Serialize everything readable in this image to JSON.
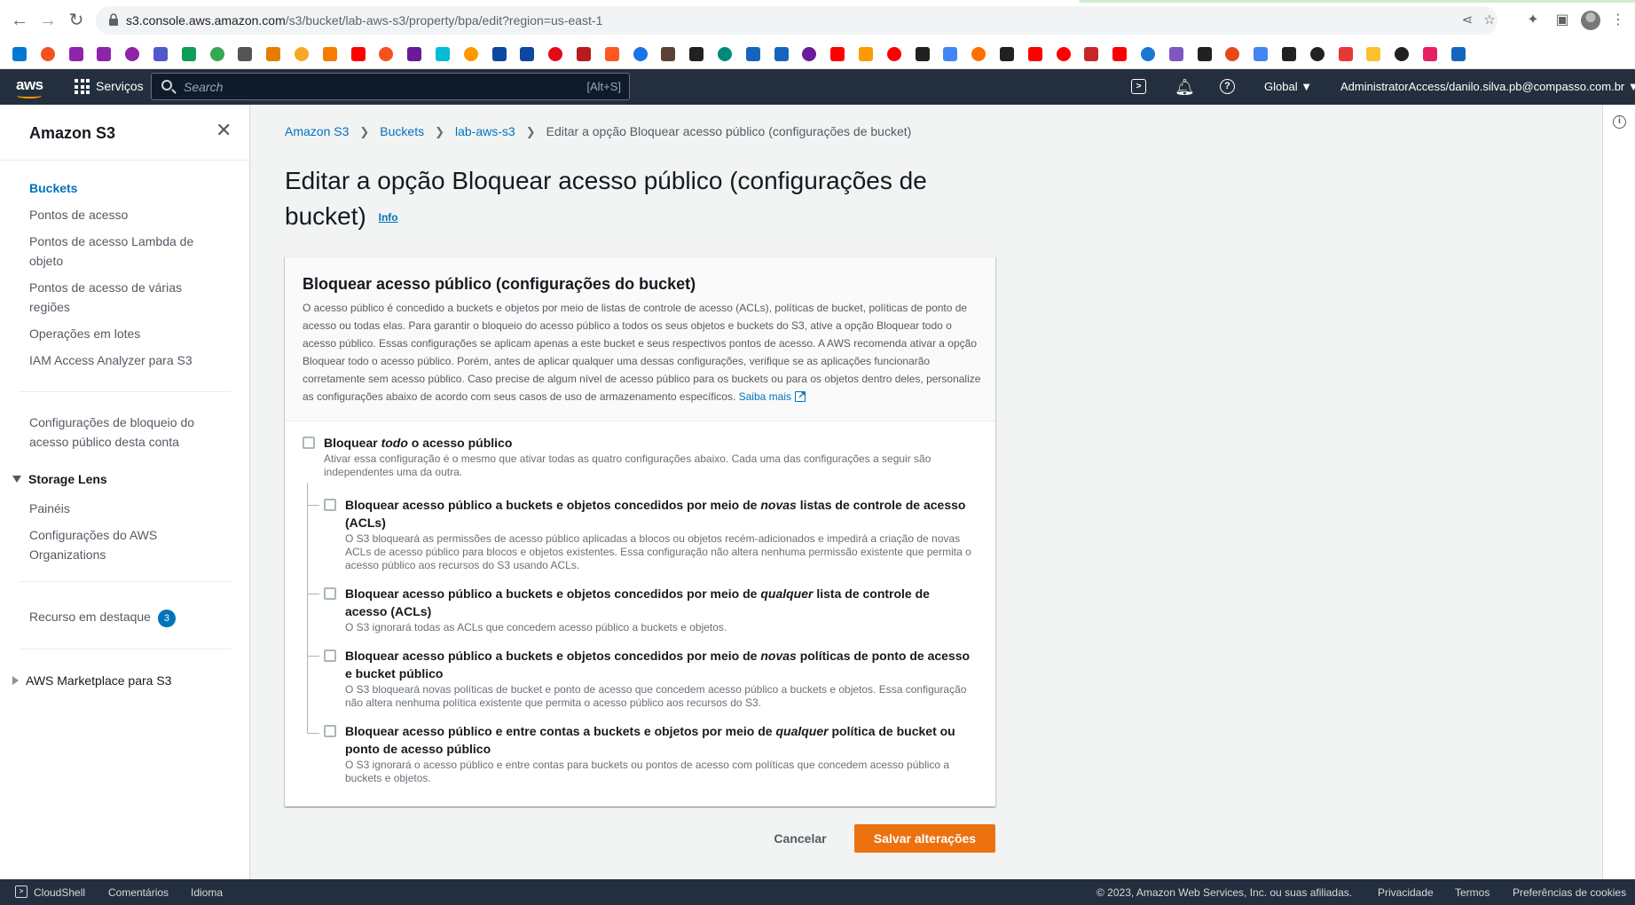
{
  "browser": {
    "url_host": "s3.console.aws.amazon.com",
    "url_path": "/s3/bucket/lab-aws-s3/property/bpa/edit?region=us-east-1",
    "bookmark_colors": [
      "#0078d4",
      "#f4511e",
      "#8e24aa",
      "#8e24aa",
      "#8e24aa",
      "#5059c9",
      "#0f9d58",
      "#34a853",
      "#555555",
      "#e67c00",
      "#f9a825",
      "#f57c00",
      "#ff0000",
      "#f4511e",
      "#6a1b9a",
      "#00bcd4",
      "#ff9800",
      "#0d47a1",
      "#0d47a1",
      "#e50914",
      "#b71c1c",
      "#ff5722",
      "#1a73e8",
      "#5d4037",
      "#212121",
      "#00897b",
      "#1565c0",
      "#1565c0",
      "#6a1b9a",
      "#ff0000",
      "#ff9900",
      "#ff0000",
      "#212121",
      "#4285f4",
      "#ff6f00",
      "#212121",
      "#ff0000",
      "#ff0000",
      "#c62828",
      "#ff0000",
      "#1976d2",
      "#7e57c2",
      "#212121",
      "#e64a19",
      "#4285f4",
      "#212121",
      "#212121",
      "#e53935",
      "#fbc02d",
      "#212121",
      "#e91e63",
      "#1565c0"
    ]
  },
  "aws_nav": {
    "logo": "aws",
    "services": "Serviços",
    "search_placeholder": "Search",
    "search_shortcut": "[Alt+S]",
    "region": "Global",
    "account": "AdministratorAccess/danilo.silva.pb@compasso.com.br"
  },
  "sidebar": {
    "title": "Amazon S3",
    "items": [
      {
        "label": "Buckets",
        "active": true
      },
      {
        "label": "Pontos de acesso"
      },
      {
        "label": "Pontos de acesso Lambda de objeto"
      },
      {
        "label": "Pontos de acesso de várias regiões"
      },
      {
        "label": "Operações em lotes"
      },
      {
        "label": "IAM Access Analyzer para S3"
      }
    ],
    "account_bpa": "Configurações de bloqueio do acesso público desta conta",
    "storage_lens": {
      "label": "Storage Lens",
      "items": [
        "Painéis",
        "Configurações do AWS Organizations"
      ]
    },
    "featured": {
      "label": "Recurso em destaque",
      "count": "3"
    },
    "marketplace": "AWS Marketplace para S3"
  },
  "breadcrumb": [
    "Amazon S3",
    "Buckets",
    "lab-aws-s3",
    "Editar a opção Bloquear acesso público (configurações de bucket)"
  ],
  "page": {
    "title": "Editar a opção Bloquear acesso público (configurações de bucket)",
    "info": "Info"
  },
  "panel": {
    "title": "Bloquear acesso público (configurações do bucket)",
    "description": "O acesso público é concedido a buckets e objetos por meio de listas de controle de acesso (ACLs), políticas de bucket, políticas de ponto de acesso ou todas elas. Para garantir o bloqueio do acesso público a todos os seus objetos e buckets do S3, ative a opção Bloquear todo o acesso público. Essas configurações se aplicam apenas a este bucket e seus respectivos pontos de acesso. A AWS recomenda ativar a opção Bloquear todo o acesso público. Porém, antes de aplicar qualquer uma dessas configurações, verifique se as aplicações funcionarão corretamente sem acesso público. Caso precise de algum nível de acesso público para os buckets ou para os objetos dentro deles, personalize as configurações abaixo de acordo com seus casos de uso de armazenamento específicos.",
    "learn_more": "Saiba mais",
    "block_all": {
      "title_pre": "Bloquear ",
      "title_em": "todo",
      "title_post": " o acesso público",
      "desc": "Ativar essa configuração é o mesmo que ativar todas as quatro configurações abaixo. Cada uma das configurações a seguir são independentes uma da outra.",
      "checked": false
    },
    "options": [
      {
        "title_pre": "Bloquear acesso público a buckets e objetos concedidos por meio de ",
        "title_em": "novas",
        "title_post": " listas de controle de acesso (ACLs)",
        "desc": "O S3 bloqueará as permissões de acesso público aplicadas a blocos ou objetos recém-adicionados e impedirá a criação de novas ACLs de acesso público para blocos e objetos existentes. Essa configuração não altera nenhuma permissão existente que permita o acesso público aos recursos do S3 usando ACLs.",
        "checked": false
      },
      {
        "title_pre": "Bloquear acesso público a buckets e objetos concedidos por meio de ",
        "title_em": "qualquer",
        "title_post": " lista de controle de acesso (ACLs)",
        "desc": "O S3 ignorará todas as ACLs que concedem acesso público a buckets e objetos.",
        "checked": false
      },
      {
        "title_pre": "Bloquear acesso público a buckets e objetos concedidos por meio de ",
        "title_em": "novas",
        "title_post": " políticas de ponto de acesso e bucket público",
        "desc": "O S3 bloqueará novas políticas de bucket e ponto de acesso que concedem acesso público a buckets e objetos. Essa configuração não altera nenhuma política existente que permita o acesso público aos recursos do S3.",
        "checked": false
      },
      {
        "title_pre": "Bloquear acesso público e entre contas a buckets e objetos por meio de ",
        "title_em": "qualquer",
        "title_post": " política de bucket ou ponto de acesso público",
        "desc": "O S3 ignorará o acesso público e entre contas para buckets ou pontos de acesso com políticas que concedem acesso público a buckets e objetos.",
        "checked": false
      }
    ]
  },
  "actions": {
    "cancel": "Cancelar",
    "save": "Salvar alterações"
  },
  "footer": {
    "cloudshell": "CloudShell",
    "feedback": "Comentários",
    "language": "Idioma",
    "copyright": "© 2023, Amazon Web Services, Inc. ou suas afiliadas.",
    "privacy": "Privacidade",
    "terms": "Termos",
    "cookies": "Preferências de cookies"
  },
  "colors": {
    "accent": "#0073bb",
    "primary_button": "#ec7211",
    "nav_bg": "#232f3e"
  }
}
